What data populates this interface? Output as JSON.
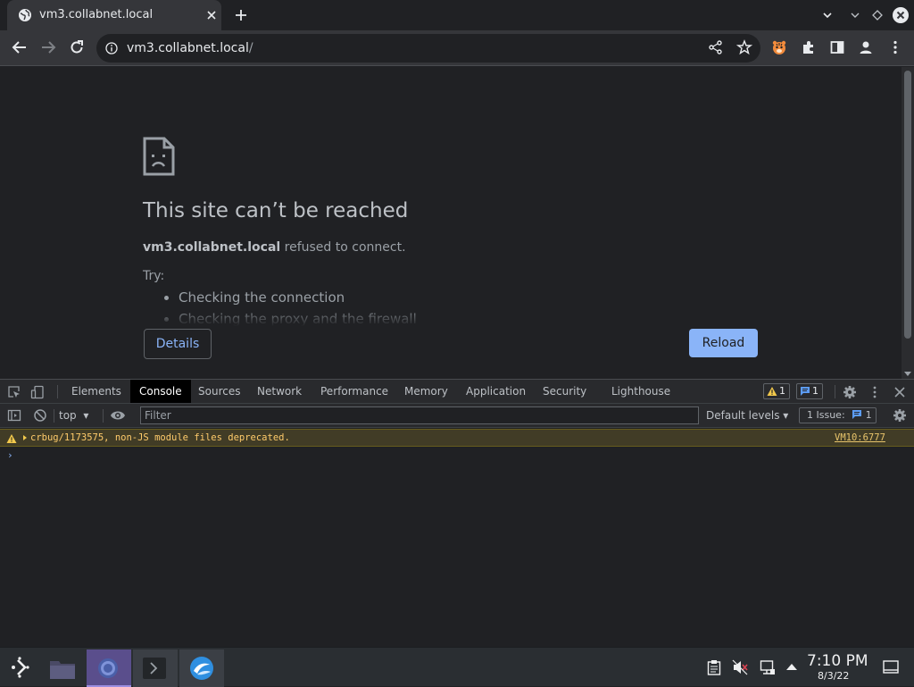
{
  "browser": {
    "tab_title": "vm3.collabnet.local",
    "url_host": "vm3.collabnet.local",
    "url_path": "/"
  },
  "page": {
    "title": "This site can’t be reached",
    "host": "vm3.collabnet.local",
    "message": " refused to connect.",
    "try_label": "Try:",
    "suggestions": [
      "Checking the connection",
      "Checking the proxy and the firewall"
    ],
    "details_label": "Details",
    "reload_label": "Reload"
  },
  "devtools": {
    "tabs": [
      "Elements",
      "Console",
      "Sources",
      "Network",
      "Performance",
      "Memory",
      "Application",
      "Security",
      "Lighthouse"
    ],
    "active_tab": "Console",
    "warnings_count": "1",
    "messages_count": "1",
    "context": "top",
    "filter_placeholder": "Filter",
    "levels_label": "Default levels",
    "issues_label": "1 Issue:",
    "issues_count": "1",
    "warning": {
      "message": "crbug/1173575, non-JS module files deprecated.",
      "source": "VM10:6777"
    },
    "prompt": "›"
  },
  "taskbar": {
    "time": "7:10 PM",
    "date": "8/3/22"
  },
  "colors": {
    "accent": "#8ab4f8",
    "warning": "#f2c94c",
    "taskbar_active": "#5a4e8c"
  }
}
